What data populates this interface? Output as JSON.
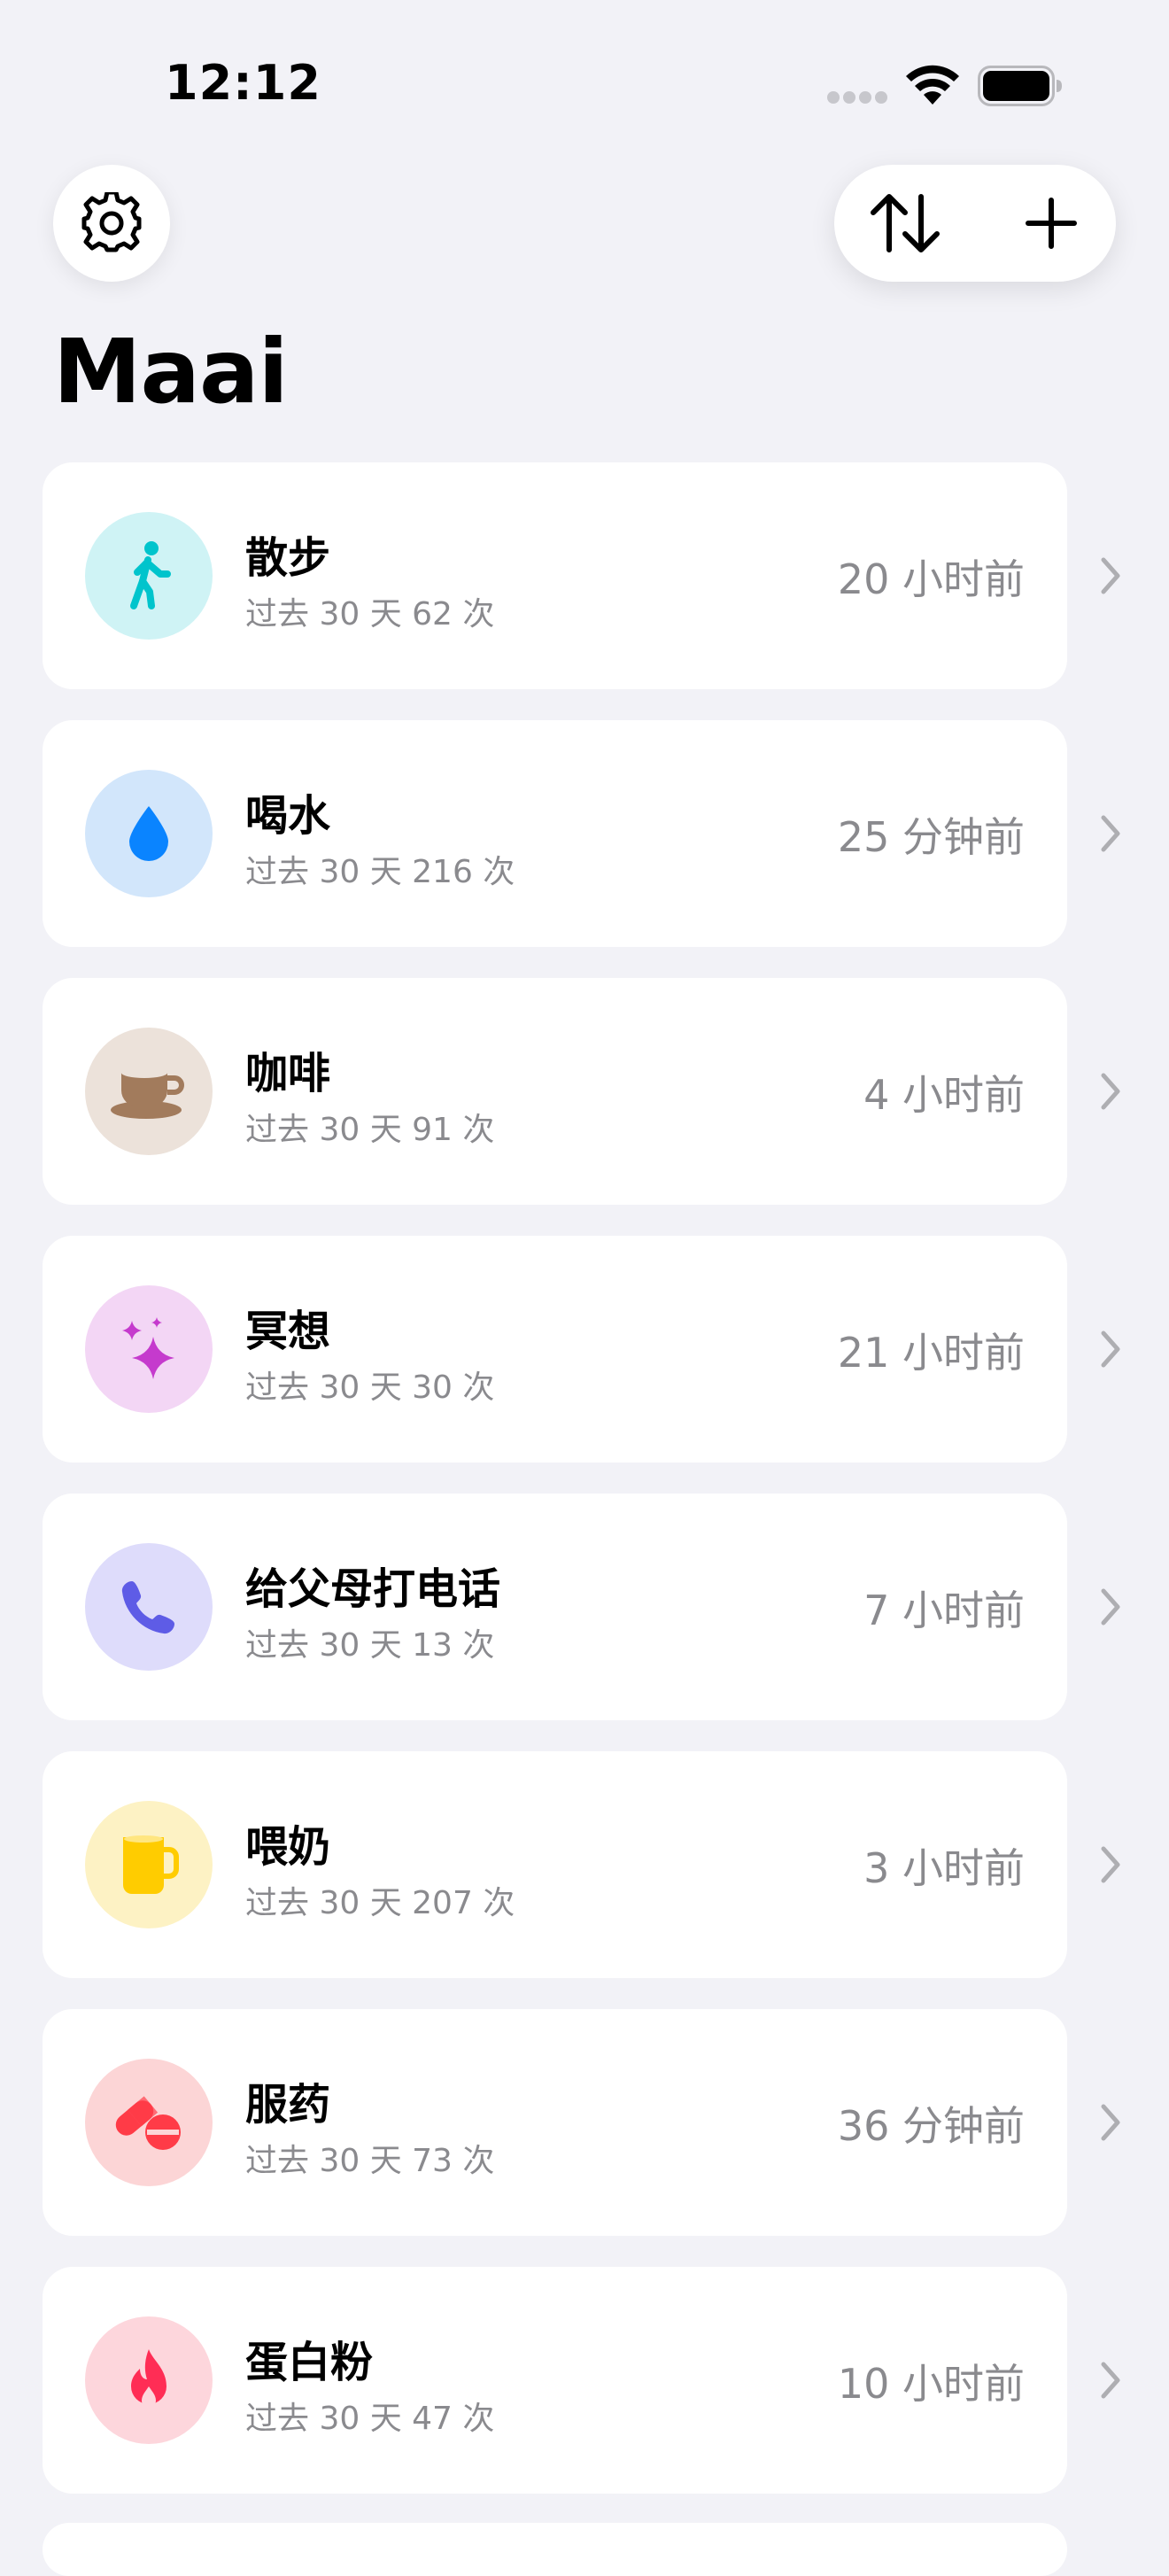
{
  "status_bar": {
    "time": "12:12"
  },
  "header": {
    "title": "Maai"
  },
  "icons": {
    "settings": "gear-icon",
    "sort": "sort-arrows-icon",
    "add": "plus-icon"
  },
  "items": [
    {
      "title": "散步",
      "subtitle": "过去 30 天 62 次",
      "time_ago": "20 小时前",
      "icon": "figure-walk-icon",
      "bg": "#CFF3F5",
      "color": "#00C4CC"
    },
    {
      "title": "喝水",
      "subtitle": "过去 30 天 216 次",
      "time_ago": "25 分钟前",
      "icon": "water-drop-icon",
      "bg": "#D2E6FB",
      "color": "#0A84FF"
    },
    {
      "title": "咖啡",
      "subtitle": "过去 30 天 91 次",
      "time_ago": "4 小时前",
      "icon": "coffee-cup-icon",
      "bg": "#ECE2DA",
      "color": "#A27B5C"
    },
    {
      "title": "冥想",
      "subtitle": "过去 30 天 30 次",
      "time_ago": "21 小时前",
      "icon": "sparkles-icon",
      "bg": "#F3D6F5",
      "color": "#C53ACD"
    },
    {
      "title": "给父母打电话",
      "subtitle": "过去 30 天 13 次",
      "time_ago": "7 小时前",
      "icon": "phone-icon",
      "bg": "#DEDCFB",
      "color": "#5E5CE6"
    },
    {
      "title": "喂奶",
      "subtitle": "过去 30 天 207 次",
      "time_ago": "3 小时前",
      "icon": "mug-icon",
      "bg": "#FDF2C4",
      "color": "#FFCC00"
    },
    {
      "title": "服药",
      "subtitle": "过去 30 天 73 次",
      "time_ago": "36 分钟前",
      "icon": "pills-icon",
      "bg": "#FCD5D6",
      "color": "#FF3B47"
    },
    {
      "title": "蛋白粉",
      "subtitle": "过去 30 天 47 次",
      "time_ago": "10 小时前",
      "icon": "flame-icon",
      "bg": "#FDD6DC",
      "color": "#FF2D55"
    }
  ]
}
